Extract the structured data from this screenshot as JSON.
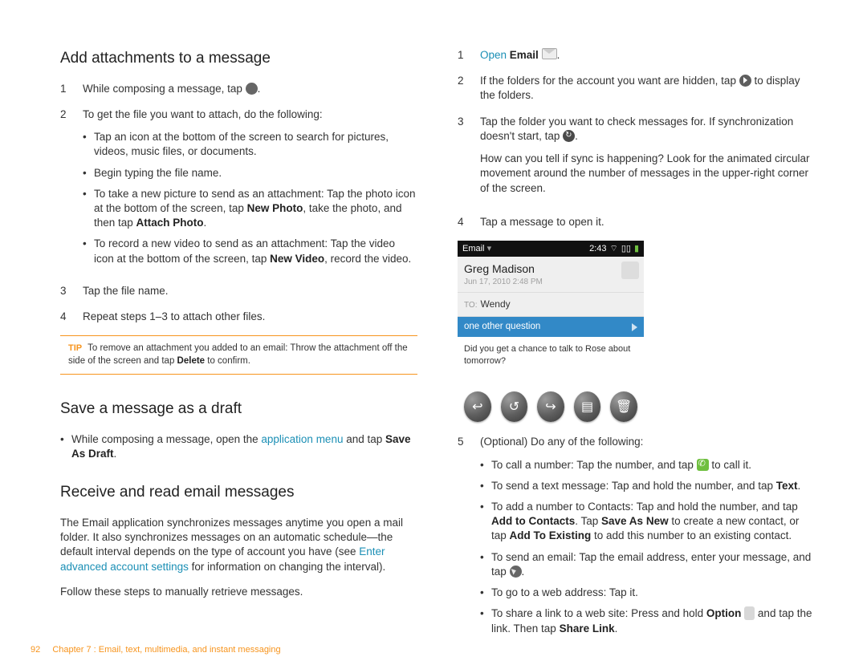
{
  "left": {
    "h1": "Add attachments to a message",
    "steps": {
      "s1": {
        "num": "1",
        "text_a": "While composing a message, tap ",
        "text_b": "."
      },
      "s2": {
        "num": "2",
        "lead": "To get the file you want to attach, do the following:",
        "b1": "Tap an icon at the bottom of the screen to search for pictures, videos, music files, or documents.",
        "b2": "Begin typing the file name.",
        "b3a": "To take a new picture to send as an attachment: Tap the photo icon at the bottom of the screen, tap ",
        "b3b": "New Photo",
        "b3c": ", take the photo, and then tap ",
        "b3d": "Attach Photo",
        "b3e": ".",
        "b4a": "To record a new video to send as an attachment: Tap the video icon at the bottom of the screen, tap ",
        "b4b": "New Video",
        "b4c": ", record the video."
      },
      "s3": {
        "num": "3",
        "text": "Tap the file name."
      },
      "s4": {
        "num": "4",
        "text": "Repeat steps 1–3 to attach other files."
      }
    },
    "tip_label": "TIP",
    "tip_a": "To remove an attachment you added to an email: Throw the attachment off the side of the screen and tap ",
    "tip_b": "Delete",
    "tip_c": " to confirm.",
    "h2": "Save a message as a draft",
    "save_a": "While composing a message, open the ",
    "save_link": "application menu",
    "save_b": " and tap ",
    "save_c": "Save As Draft",
    "save_d": ".",
    "h3": "Receive and read email messages",
    "recv_a": "The Email application synchronizes messages anytime you open a mail folder. It also synchronizes messages on an automatic schedule—the default interval depends on the type of account you have (see ",
    "recv_link": "Enter advanced account settings",
    "recv_b": " for information on changing the interval).",
    "recv_follow": "Follow these steps to manually retrieve messages."
  },
  "right": {
    "r1": {
      "num": "1",
      "link": "Open ",
      "bold": "Email",
      "end": " ",
      "period": "."
    },
    "r2": {
      "num": "2",
      "a": "If the folders for the account you want are hidden, tap ",
      "b": " to display the folders."
    },
    "r3": {
      "num": "3",
      "a": "Tap the folder you want to check messages for. If synchronization doesn't start, tap ",
      "b": ".",
      "para": "How can you tell if sync is happening? Look for the animated circular movement around the number of messages in the upper-right corner of the screen."
    },
    "r4": {
      "num": "4",
      "text": "Tap a message to open it."
    },
    "r5": {
      "num": "5",
      "lead": "(Optional) Do any of the following:",
      "b1a": "To call a number: Tap the number, and tap ",
      "b1b": " to call it.",
      "b2a": "To send a text message: Tap and hold the number, and tap ",
      "b2b": "Text",
      "b2c": ".",
      "b3a": "To add a number to Contacts: Tap and hold the number, and tap ",
      "b3b": "Add to Contacts",
      "b3c": ". Tap ",
      "b3d": "Save As New",
      "b3e": " to create a new contact, or tap ",
      "b3f": "Add To Existing",
      "b3g": " to add this number to an existing contact.",
      "b4a": "To send an email: Tap the email address, enter your message, and tap ",
      "b4b": ".",
      "b5": "To go to a web address: Tap it.",
      "b6a": "To share a link to a web site: Press and hold ",
      "b6b": "Option",
      "b6c": " ",
      "b6d": " and tap the link. Then tap ",
      "b6e": "Share Link",
      "b6f": "."
    }
  },
  "mock": {
    "status_left": "Email",
    "status_time": "2:43",
    "from": "Greg Madison",
    "date": "Jun 17, 2010 2:48 PM",
    "to_label": "TO:",
    "to_value": "Wendy",
    "subject": "one other question",
    "body": "Did you get a chance to talk to Rose about tomorrow?"
  },
  "footer": {
    "page": "92",
    "chapter": "Chapter 7 : Email, text, multimedia, and instant messaging"
  }
}
